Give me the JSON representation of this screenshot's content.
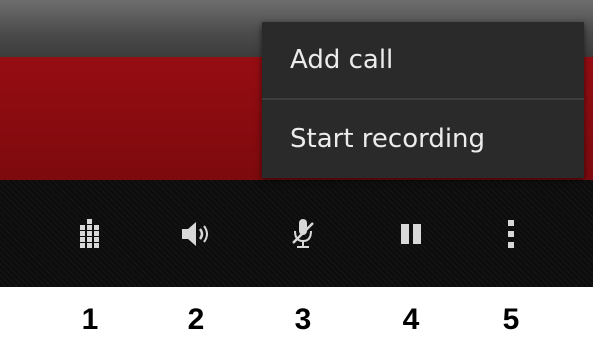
{
  "menu": {
    "items": [
      {
        "label": "Add call"
      },
      {
        "label": "Start recording"
      }
    ]
  },
  "controls": [
    {
      "icon": "dialpad-icon",
      "number": "1"
    },
    {
      "icon": "speaker-icon",
      "number": "2"
    },
    {
      "icon": "mute-mic-icon",
      "number": "3"
    },
    {
      "icon": "pause-icon",
      "number": "4"
    },
    {
      "icon": "overflow-menu-icon",
      "number": "5"
    }
  ],
  "colors": {
    "call_band": "#8a0b10",
    "top_bar": "#555555",
    "control_bar": "#0d0d0d",
    "menu_bg": "#2a2a2a",
    "icon": "#d8d8d8"
  }
}
